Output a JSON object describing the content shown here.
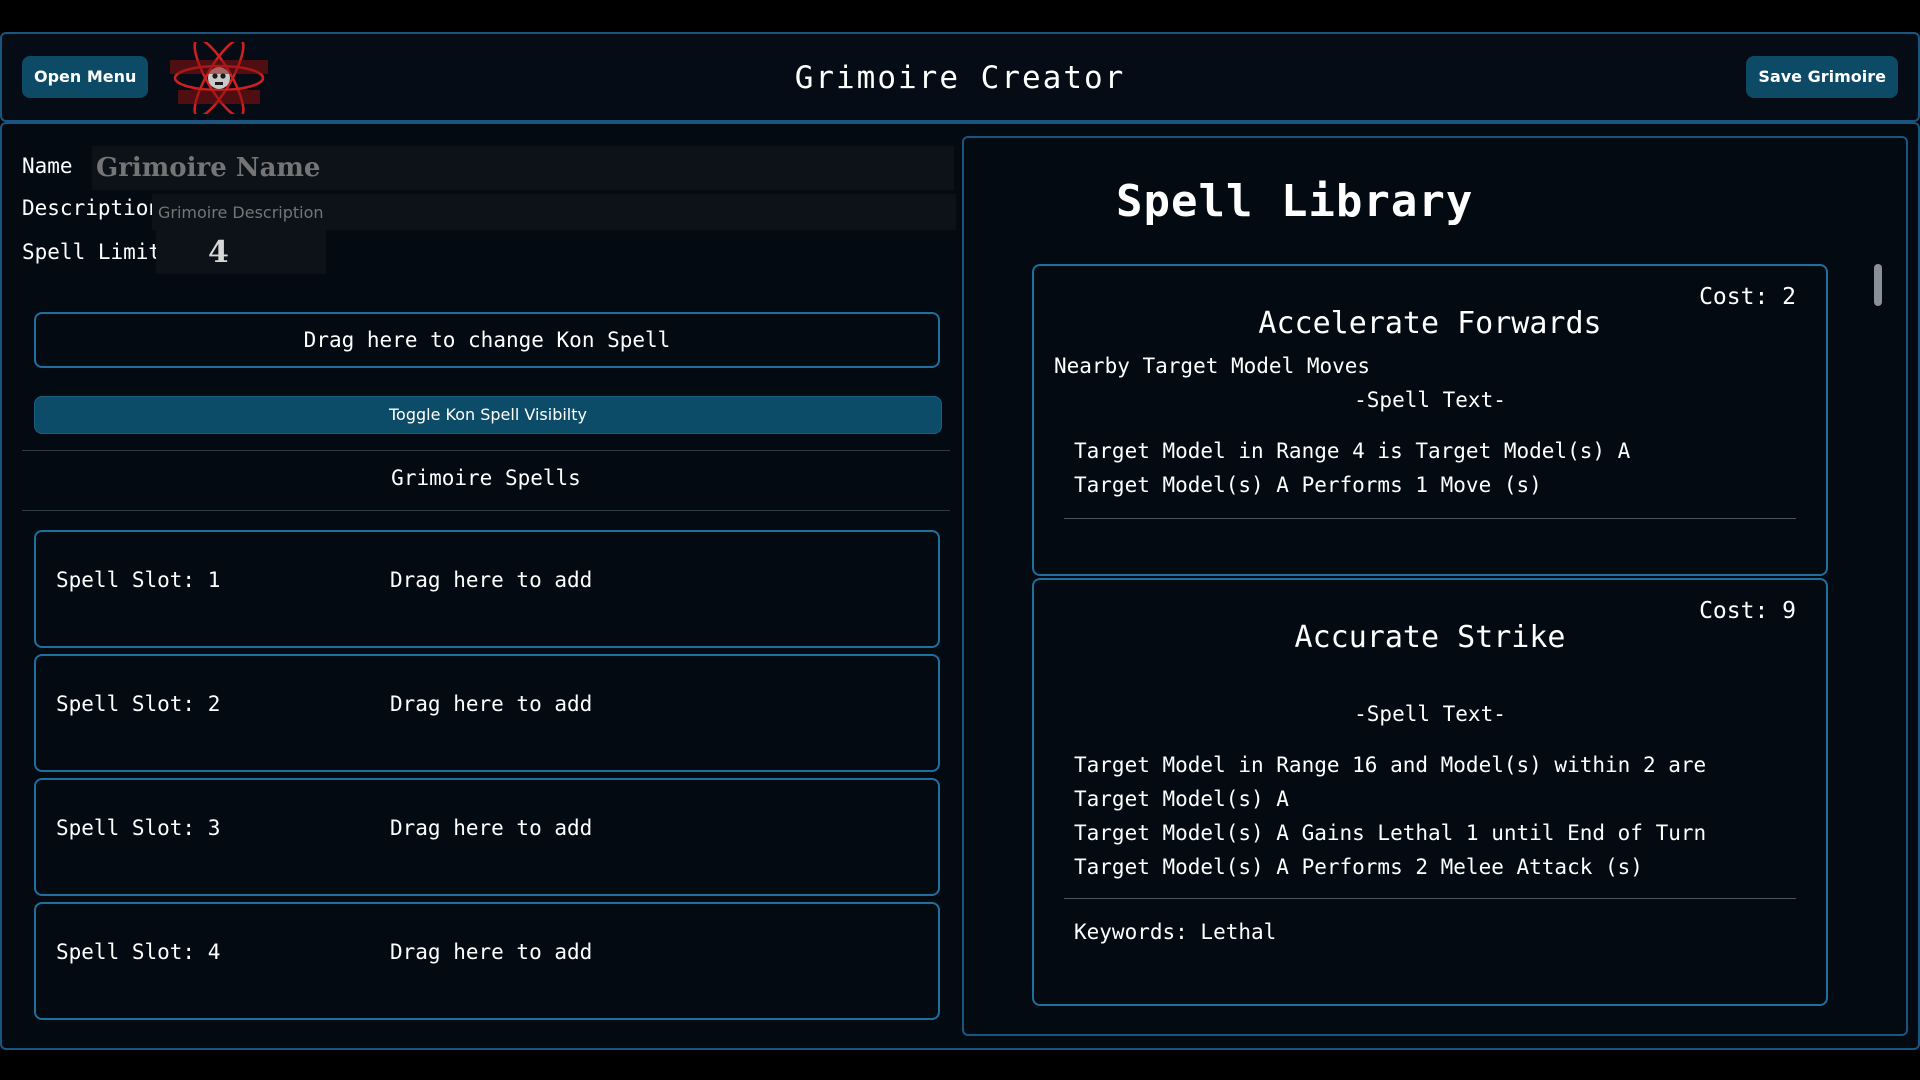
{
  "header": {
    "open_menu_label": "Open Menu",
    "title": "Grimoire Creator",
    "save_label": "Save Grimoire",
    "logo_icon": "atomic-skull-logo-icon"
  },
  "form": {
    "name_label": "Name",
    "name_placeholder": "Grimoire Name",
    "description_label": "Description",
    "description_placeholder": "Grimoire Description",
    "spell_limit_label": "Spell Limit",
    "spell_limit_value": "4",
    "kon_drop_label": "Drag here to change Kon Spell",
    "kon_toggle_label": "Toggle Kon Spell Visibilty"
  },
  "grimoire": {
    "title": "Grimoire Spells",
    "slots": [
      {
        "label": "Spell Slot: 1",
        "drop": "Drag here to add"
      },
      {
        "label": "Spell Slot: 2",
        "drop": "Drag here to add"
      },
      {
        "label": "Spell Slot: 3",
        "drop": "Drag here to add"
      },
      {
        "label": "Spell Slot: 4",
        "drop": "Drag here to add"
      }
    ]
  },
  "library": {
    "title": "Spell Library",
    "spells": [
      {
        "cost": "Cost: 2",
        "name": "Accelerate Forwards",
        "summary": "Nearby Target Model Moves",
        "text_title": "-Spell Text-",
        "lines": [
          "Target Model in Range 4 is Target Model(s) A",
          "Target Model(s) A Performs 1 Move (s)"
        ],
        "keywords": ""
      },
      {
        "cost": "Cost: 9",
        "name": "Accurate Strike",
        "summary": "",
        "text_title": "-Spell Text-",
        "lines": [
          "Target Model in Range 16 and Model(s) within 2 are Target Model(s) A",
          "Target Model(s) A Gains Lethal 1 until End of Turn",
          "Target Model(s) A Performs 2 Melee Attack (s)"
        ],
        "keywords": "Keywords: Lethal"
      }
    ]
  },
  "colors": {
    "accent": "#1f6f9c",
    "button": "#0c4a66",
    "background": "#030a12"
  }
}
